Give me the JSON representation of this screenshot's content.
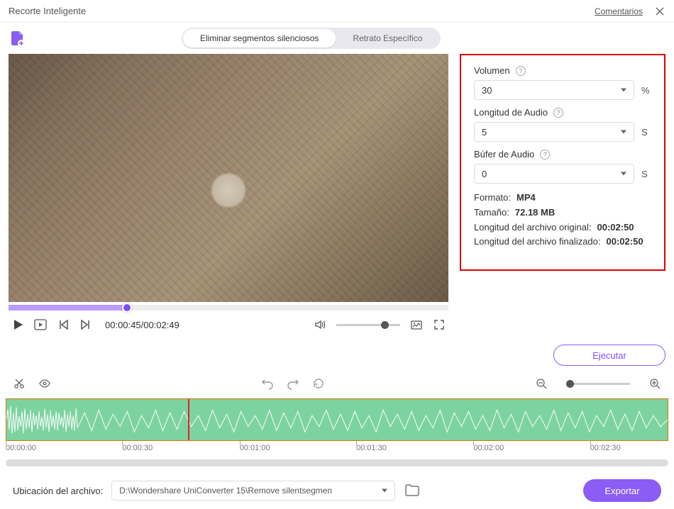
{
  "titlebar": {
    "title": "Recorte Inteligente",
    "comments": "Comentarios"
  },
  "tabs": {
    "t1": "Eliminar segmentos silenciosos",
    "t2": "Retrato Específico"
  },
  "player": {
    "time_current": "00:00:45",
    "time_total": "00:02:49",
    "time_combined": "00:00:45/00:02:49"
  },
  "params": {
    "volume": {
      "label": "Volumen",
      "value": "30",
      "unit": "%"
    },
    "audio_length": {
      "label": "Longitud de Audio",
      "value": "5",
      "unit": "S"
    },
    "audio_buffer": {
      "label": "Búfer de Audio",
      "value": "0",
      "unit": "S"
    }
  },
  "meta": {
    "format_label": "Formato:",
    "format_value": "MP4",
    "size_label": "Tamaño:",
    "size_value": "72.18 MB",
    "orig_label": "Longitud del archivo original:",
    "orig_value": "00:02:50",
    "final_label": "Longitud del archivo finalizado:",
    "final_value": "00:02:50"
  },
  "buttons": {
    "run": "Ejecutar",
    "export": "Exportar"
  },
  "ruler": {
    "t0": "00:00:00",
    "t1": "00:00:30",
    "t2": "00:01:00",
    "t3": "00:01:30",
    "t4": "00:02:00",
    "t5": "00:02:30"
  },
  "footer": {
    "location_label": "Ubicación del archivo:",
    "path": "D:\\Wondershare UniConverter 15\\Remove silentsegmen"
  }
}
